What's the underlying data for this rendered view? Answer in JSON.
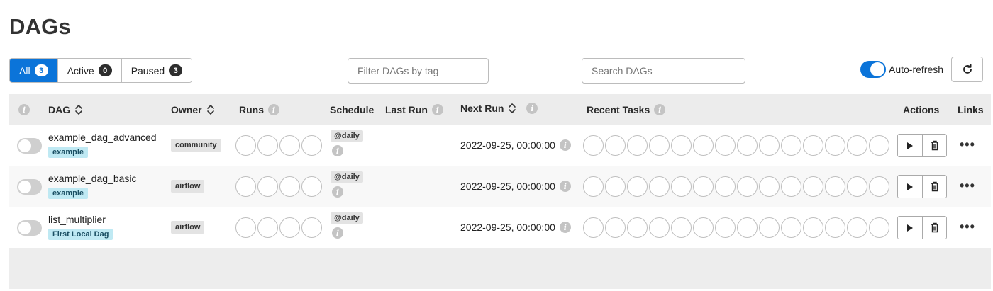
{
  "page": {
    "title": "DAGs"
  },
  "status_filter": [
    {
      "label": "All",
      "count": "3"
    },
    {
      "label": "Active",
      "count": "0"
    },
    {
      "label": "Paused",
      "count": "3"
    }
  ],
  "tag_filter": {
    "placeholder": "Filter DAGs by tag"
  },
  "search": {
    "placeholder": "Search DAGs"
  },
  "auto_refresh": {
    "label": "Auto-refresh",
    "enabled": true
  },
  "table": {
    "headers": {
      "dag": "DAG",
      "owner": "Owner",
      "runs": "Runs",
      "schedule": "Schedule",
      "last_run": "Last Run",
      "next_run": "Next Run",
      "recent_tasks": "Recent Tasks",
      "actions": "Actions",
      "links": "Links"
    },
    "rows": [
      {
        "dag_id": "example_dag_advanced",
        "tag": "example",
        "owner": "community",
        "schedule": "@daily",
        "next_run": "2022-09-25, 00:00:00",
        "paused": true
      },
      {
        "dag_id": "example_dag_basic",
        "tag": "example",
        "owner": "airflow",
        "schedule": "@daily",
        "next_run": "2022-09-25, 00:00:00",
        "paused": true
      },
      {
        "dag_id": "list_multiplier",
        "tag": "First Local Dag",
        "owner": "airflow",
        "schedule": "@daily",
        "next_run": "2022-09-25, 00:00:00",
        "paused": true
      }
    ],
    "links_glyph": "•••"
  },
  "colors": {
    "accent": "#0b74d9",
    "tag_bg": "#bfe9f3",
    "badge_bg": "#e3e3e3"
  },
  "icons": [
    "info-icon",
    "sort-icon",
    "refresh-icon",
    "play-icon",
    "trash-icon",
    "more-icon"
  ]
}
